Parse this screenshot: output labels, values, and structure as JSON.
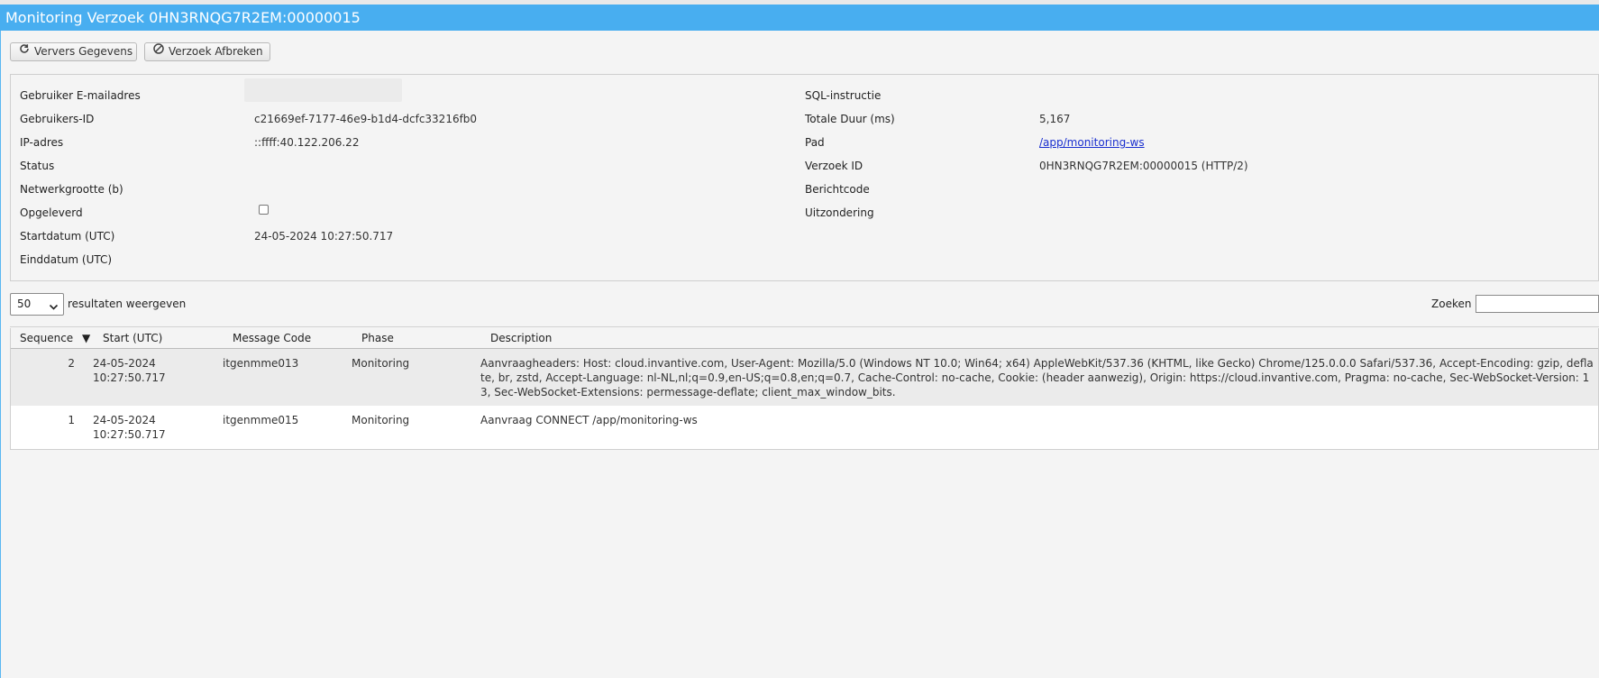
{
  "window": {
    "title": "Monitoring Verzoek 0HN3RNQG7R2EM:00000015"
  },
  "toolbar": {
    "refresh_label": "Ververs Gegevens",
    "abort_label": "Verzoek Afbreken"
  },
  "details": {
    "left": [
      {
        "label": "Gebruiker E-mailadres",
        "value": ""
      },
      {
        "label": "Gebruikers-ID",
        "value": "c21669ef-7177-46e9-b1d4-dcfc33216fb0"
      },
      {
        "label": "IP-adres",
        "value": "::ffff:40.122.206.22"
      },
      {
        "label": "Status",
        "value": ""
      },
      {
        "label": "Netwerkgrootte (b)",
        "value": ""
      },
      {
        "label": "Opgeleverd",
        "value": "",
        "checked": false
      },
      {
        "label": "Startdatum (UTC)",
        "value": "24-05-2024 10:27:50.717"
      },
      {
        "label": "Einddatum (UTC)",
        "value": ""
      }
    ],
    "right": [
      {
        "label": "SQL-instructie",
        "value": ""
      },
      {
        "label": "Totale Duur (ms)",
        "value": "5,167"
      },
      {
        "label": "Pad",
        "value": "/app/monitoring-ws"
      },
      {
        "label": "Verzoek ID",
        "value": "0HN3RNQG7R2EM:00000015 (HTTP/2)"
      },
      {
        "label": "Berichtcode",
        "value": ""
      },
      {
        "label": "Uitzondering",
        "value": ""
      }
    ]
  },
  "list_controls": {
    "page_size": "50",
    "page_size_suffix": "resultaten weergeven",
    "search_label": "Zoeken",
    "search_value": ""
  },
  "table": {
    "columns": [
      "Sequence",
      "Start (UTC)",
      "Message Code",
      "Phase",
      "Description"
    ],
    "sort_indicator": "▼",
    "rows": [
      {
        "sequence": "2",
        "start_date": "24-05-2024",
        "start_time": "10:27:50.717",
        "message_code": "itgenmme013",
        "phase": "Monitoring",
        "description": "Aanvraagheaders: Host: cloud.invantive.com, User-Agent: Mozilla/5.0 (Windows NT 10.0; Win64; x64) AppleWebKit/537.36 (KHTML, like Gecko) Chrome/125.0.0.0 Safari/537.36, Accept-Encoding: gzip, deflate, br, zstd, Accept-Language: nl-NL,nl;q=0.9,en-US;q=0.8,en;q=0.7, Cache-Control: no-cache, Cookie: (header aanwezig), Origin: https://cloud.invantive.com, Pragma: no-cache, Sec-WebSocket-Version: 13, Sec-WebSocket-Extensions: permessage-deflate; client_max_window_bits."
      },
      {
        "sequence": "1",
        "start_date": "24-05-2024",
        "start_time": "10:27:50.717",
        "message_code": "itgenmme015",
        "phase": "Monitoring",
        "description": "Aanvraag CONNECT /app/monitoring-ws"
      }
    ]
  }
}
